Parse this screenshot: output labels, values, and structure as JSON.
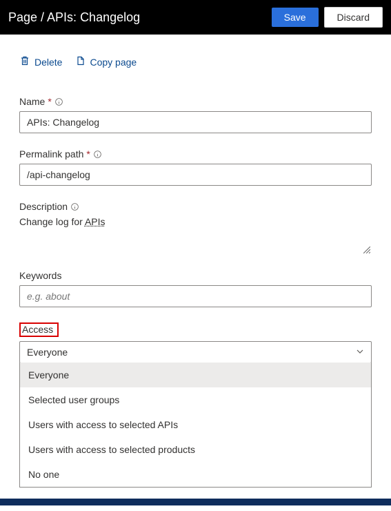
{
  "header": {
    "title": "Page / APIs: Changelog",
    "save_label": "Save",
    "discard_label": "Discard"
  },
  "toolbar": {
    "delete_label": "Delete",
    "copy_label": "Copy page"
  },
  "fields": {
    "name": {
      "label": "Name",
      "value": "APIs: Changelog"
    },
    "permalink": {
      "label": "Permalink path",
      "value": "/api-changelog"
    },
    "description": {
      "label": "Description",
      "value_prefix": "Change log for ",
      "value_underlined": "APIs"
    },
    "keywords": {
      "label": "Keywords",
      "placeholder": "e.g. about",
      "value": ""
    },
    "access": {
      "label": "Access",
      "selected": "Everyone",
      "options": [
        "Everyone",
        "Selected user groups",
        "Users with access to selected APIs",
        "Users with access to selected products",
        "No one"
      ]
    }
  }
}
